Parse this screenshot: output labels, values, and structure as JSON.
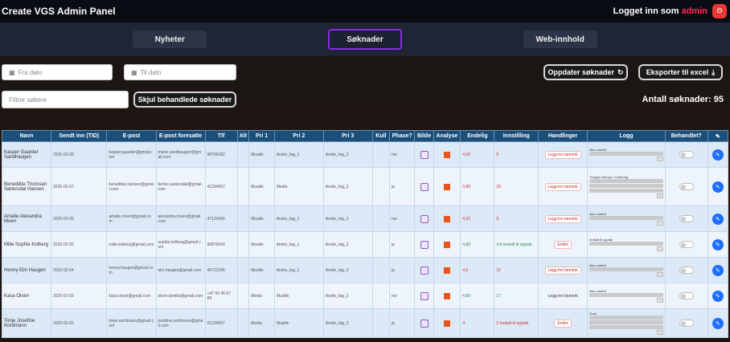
{
  "header": {
    "title": "Create VGS Admin Panel",
    "login_prefix": "Logget inn som ",
    "login_user": "admin",
    "logout_label": "⏻"
  },
  "tabs": [
    {
      "label": "Nyheter",
      "active": false
    },
    {
      "label": "Søknader",
      "active": true
    },
    {
      "label": "Web-innhold",
      "active": false
    }
  ],
  "filters": {
    "from_placeholder": "Fra dato",
    "to_placeholder": "Til dato",
    "search_placeholder": "Filtrer søkere",
    "toggle_handled_label": "Skjul behandlede søknader",
    "update_label": "Oppdater søknader",
    "export_label": "Eksporter til excel",
    "count_label": "Antall søknader: 95"
  },
  "table": {
    "columns": [
      "Navn",
      "Sendt inn (TID)",
      "E-post",
      "E-post foresatte",
      "Tlf",
      "Alt",
      "Pri 1",
      "Pri 2",
      "Pri 3",
      "Kull",
      "Phase?",
      "Bilde",
      "Analyse",
      "Endelig",
      "Innstilling",
      "Handlinger",
      "Logg",
      "Behandlet?",
      "✎"
    ],
    "rows": [
      {
        "name": "Kasper Gaarder Sandhaugen",
        "date": "2025-02-08",
        "email": "kasper.gaarder@gmail.com",
        "parent": "marte.sandhaugen@gmail.com",
        "phone": "98765432",
        "alt": "",
        "p1": "Musikk",
        "p2": "Andre_fag_1",
        "p3": "Andre_fag_2",
        "kull": "",
        "phase": "nei",
        "grade": "4,00",
        "grade_class": "red",
        "score": "8",
        "action": "Legg inn bemerk",
        "action_style": "btn",
        "status": "Ikke vurdert",
        "log_lines": 1
      },
      {
        "name": "Benedikte Thomsen Sætersdal Hansen",
        "date": "2025-02-07",
        "email": "benedikte.hansen@gmail.com",
        "parent": "bente.saetersdal@gmail.com",
        "phone": "41234567",
        "alt": "",
        "p1": "Musikk",
        "p2": "Media",
        "p3": "Andre_fag_2",
        "kull": "",
        "phase": "ja",
        "grade": "3,80",
        "grade_class": "red",
        "score": "16",
        "action": "Legg inn bemerk",
        "action_style": "btn",
        "status": "Trenger intervju / vurdering",
        "log_lines": 3
      },
      {
        "name": "Amalie Alexandra Moen",
        "date": "2025-02-06",
        "email": "amalie.moen@gmail.com",
        "parent": "alexandra.moen@gmail.com",
        "phone": "47123456",
        "alt": "",
        "p1": "Musikk",
        "p2": "Andre_fag_1",
        "p3": "Andre_fag_2",
        "kull": "",
        "phase": "nei",
        "grade": "4,20",
        "grade_class": "red",
        "score": "9",
        "action": "Legg inn bemerk",
        "action_style": "btn",
        "status": "Ikke vurdert",
        "log_lines": 1
      },
      {
        "name": "Mille Sophie Kolberg",
        "date": "2025-02-05",
        "email": "mille.kolberg@gmail.com",
        "parent": "sophie.kolberg@gmail.com",
        "phone": "90876543",
        "alt": "",
        "p1": "Musikk",
        "p2": "Andre_fag_1",
        "p3": "Andre_fag_2",
        "kull": "",
        "phase": "ja",
        "grade": "4,80",
        "grade_class": "green",
        "score": "4,8 Innkall til opptak",
        "action": "Endre",
        "action_style": "btn",
        "status": "Innkalt til opptak",
        "log_lines": 1
      },
      {
        "name": "Henny Elin Haugen",
        "date": "2025-02-04",
        "email": "henny.haugen@gmail.com",
        "parent": "elin.haugen@gmail.com",
        "phone": "46712345",
        "alt": "",
        "p1": "Musikk",
        "p2": "Andre_fag_1",
        "p3": "Andre_fag_2",
        "kull": "",
        "phase": "ja",
        "grade": "4,5",
        "grade_class": "red",
        "score": "15",
        "action": "Legg inn bemerk",
        "action_style": "btn",
        "status": "Ikke vurdert",
        "log_lines": 1
      },
      {
        "name": "Kasa Olsen",
        "date": "2025-02-03",
        "email": "kasa.olsen@gmail.com",
        "parent": "olsen.familie@gmail.com",
        "phone": "+47 93 45 67 89",
        "alt": "",
        "p1": "Media",
        "p2": "Musikk",
        "p3": "Andre_fag_2",
        "kull": "",
        "phase": "nei",
        "grade": "4,80",
        "grade_class": "green",
        "score": "17",
        "action": "Legg inn bemerk",
        "action_style": "plain",
        "status": "Ikke vurdert",
        "log_lines": 1
      },
      {
        "name": "Tonje Josefine Nordmann",
        "date": "2025-02-02",
        "email": "tonje.nordmann@gmail.com",
        "parent": "josefine.nordmann@gmail.com",
        "phone": "91234567",
        "alt": "",
        "p1": "Media",
        "p2": "Musikk",
        "p3": "Andre_fag_2",
        "kull": "",
        "phase": "ja",
        "grade": "4",
        "grade_class": "red",
        "score": "5 Innkall til opptak",
        "action": "Endre",
        "action_style": "btn",
        "status": "Godt",
        "log_lines": 3
      }
    ]
  },
  "colors": {
    "accent": "#8a2be2",
    "header_blue": "#1b4f7a",
    "edit_blue": "#1e6fff",
    "danger": "#e53935"
  }
}
